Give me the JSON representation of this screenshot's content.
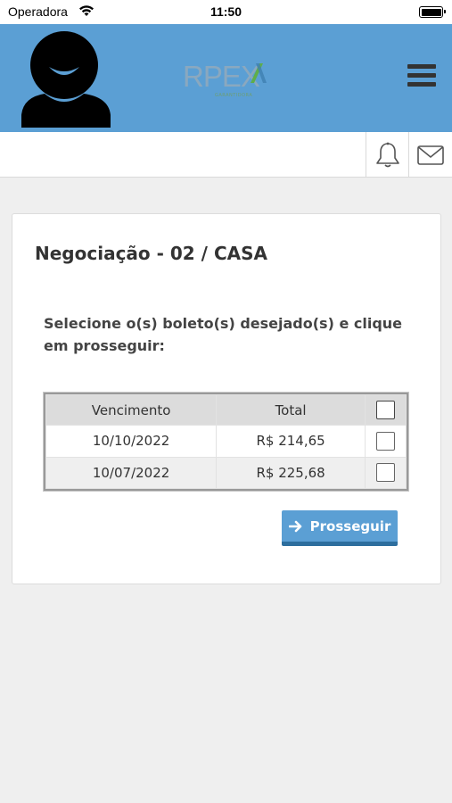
{
  "status_bar": {
    "carrier": "Operadora",
    "time": "11:50"
  },
  "header": {
    "logo_text": "RPEX",
    "logo_subtitle": "GARANTIDORA",
    "icons": [
      "user-avatar-icon",
      "menu-icon",
      "bell-icon",
      "mail-icon"
    ]
  },
  "card": {
    "title": "Negociação - 02 / CASA",
    "instruction": "Selecione o(s) boleto(s) desejado(s) e clique em prosseguir:",
    "table": {
      "columns": [
        "Vencimento",
        "Total"
      ],
      "rows": [
        {
          "vencimento": "10/10/2022",
          "total": "R$ 214,65",
          "checked": false
        },
        {
          "vencimento": "10/07/2022",
          "total": "R$ 225,68",
          "checked": false
        }
      ]
    },
    "proceed_label": "Prosseguir"
  },
  "colors": {
    "header_bg": "#5b9fd4",
    "button_bg": "#5b9fd4",
    "button_border": "#2d6e9e",
    "page_bg": "#efefef"
  }
}
